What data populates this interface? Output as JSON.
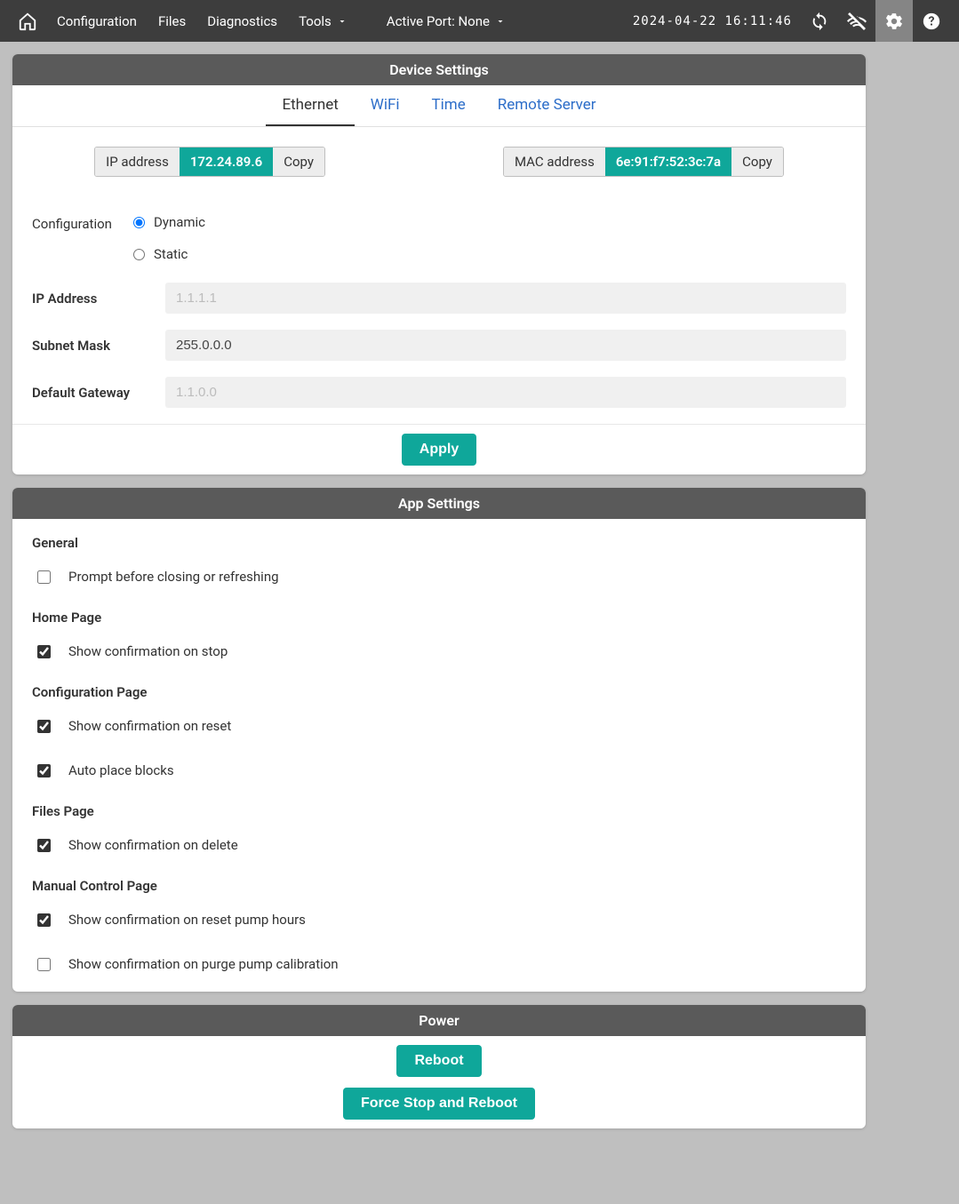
{
  "topbar": {
    "nav": {
      "configuration": "Configuration",
      "files": "Files",
      "diagnostics": "Diagnostics",
      "tools": "Tools",
      "active_port": "Active Port: None"
    },
    "timestamp": "2024-04-22 16:11:46"
  },
  "deviceSettings": {
    "title": "Device Settings",
    "tabs": {
      "ethernet": "Ethernet",
      "wifi": "WiFi",
      "time": "Time",
      "remote": "Remote Server"
    },
    "ip": {
      "label": "IP address",
      "value": "172.24.89.6",
      "copy": "Copy"
    },
    "mac": {
      "label": "MAC address",
      "value": "6e:91:f7:52:3c:7a",
      "copy": "Copy"
    },
    "config_label": "Configuration",
    "radio_dynamic": "Dynamic",
    "radio_static": "Static",
    "ip_address_label": "IP Address",
    "ip_address_ph": "1.1.1.1",
    "subnet_label": "Subnet Mask",
    "subnet_value": "255.0.0.0",
    "gateway_label": "Default Gateway",
    "gateway_ph": "1.1.0.0",
    "apply": "Apply"
  },
  "appSettings": {
    "title": "App Settings",
    "general": {
      "title": "General",
      "prompt_close": "Prompt before closing or refreshing"
    },
    "home": {
      "title": "Home Page",
      "confirm_stop": "Show confirmation on stop"
    },
    "config": {
      "title": "Configuration Page",
      "confirm_reset": "Show confirmation on reset",
      "auto_place": "Auto place blocks"
    },
    "files": {
      "title": "Files Page",
      "confirm_delete": "Show confirmation on delete"
    },
    "manual": {
      "title": "Manual Control Page",
      "confirm_reset_pump": "Show confirmation on reset pump hours",
      "confirm_purge": "Show confirmation on purge pump calibration"
    }
  },
  "power": {
    "title": "Power",
    "reboot": "Reboot",
    "force": "Force Stop and Reboot"
  }
}
